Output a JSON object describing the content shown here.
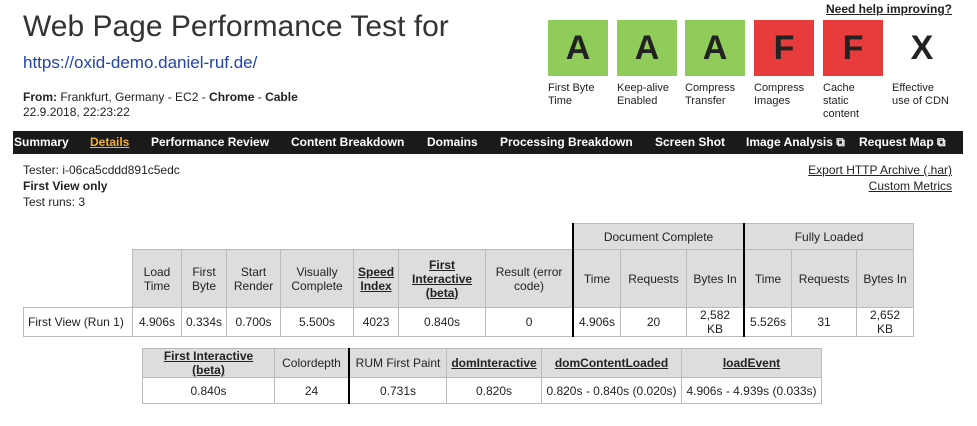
{
  "header": {
    "title": "Web Page Performance Test for",
    "url": "https://oxid-demo.daniel-ruf.de/",
    "from_label": "From:",
    "from_location": "Frankfurt, Germany - EC2 - ",
    "from_browser": "Chrome",
    "from_sep": " - ",
    "from_connection": "Cable",
    "date": "22.9.2018, 22:23:22",
    "help": "Need help improving?"
  },
  "grades": [
    {
      "letter": "A",
      "label": "First Byte Time",
      "status": "green"
    },
    {
      "letter": "A",
      "label": "Keep-alive Enabled",
      "status": "green"
    },
    {
      "letter": "A",
      "label": "Compress Transfer",
      "status": "green"
    },
    {
      "letter": "F",
      "label": "Compress Images",
      "status": "red"
    },
    {
      "letter": "F",
      "label": "Cache static content",
      "status": "red"
    },
    {
      "letter": "X",
      "label": "Effective use of CDN",
      "status": "none"
    }
  ],
  "nav": [
    "Summary",
    "Details",
    "Performance Review",
    "Content Breakdown",
    "Domains",
    "Processing Breakdown",
    "Screen Shot",
    "Image Analysis",
    "Request Map"
  ],
  "nav_active": "Details",
  "test": {
    "tester": "Tester: i-06ca5cddd891c5edc",
    "view": "First View only",
    "runs": "Test runs: 3",
    "export": "Export HTTP Archive (.har)",
    "metrics": "Custom Metrics"
  },
  "table1": {
    "group_doc": "Document Complete",
    "group_full": "Fully Loaded",
    "headers": [
      "Load Time",
      "First Byte",
      "Start Render",
      "Visually Complete",
      "Speed Index",
      "First Interactive (beta)",
      "Result (error code)",
      "Time",
      "Requests",
      "Bytes In",
      "Time",
      "Requests",
      "Bytes In"
    ],
    "row_label": "First View (",
    "row_link": "Run 1",
    "row_label_end": ")",
    "values": [
      "4.906s",
      "0.334s",
      "0.700s",
      "5.500s",
      "4023",
      "0.840s",
      "0",
      "4.906s",
      "20",
      "2,582 KB",
      "5.526s",
      "31",
      "2,652 KB"
    ]
  },
  "table2": {
    "headers": [
      "First Interactive (beta)",
      "Colordepth",
      "RUM First Paint",
      "domInteractive",
      "domContentLoaded",
      "loadEvent"
    ],
    "values": [
      "0.840s",
      "24",
      "0.731s",
      "0.820s",
      "0.820s - 0.840s (0.020s)",
      "4.906s - 4.939s (0.033s)"
    ]
  },
  "colors": {
    "green": "#8fcc5a",
    "red": "#e83b3b",
    "nav_bg": "#1a1a1a",
    "nav_active": "#f0b030"
  }
}
